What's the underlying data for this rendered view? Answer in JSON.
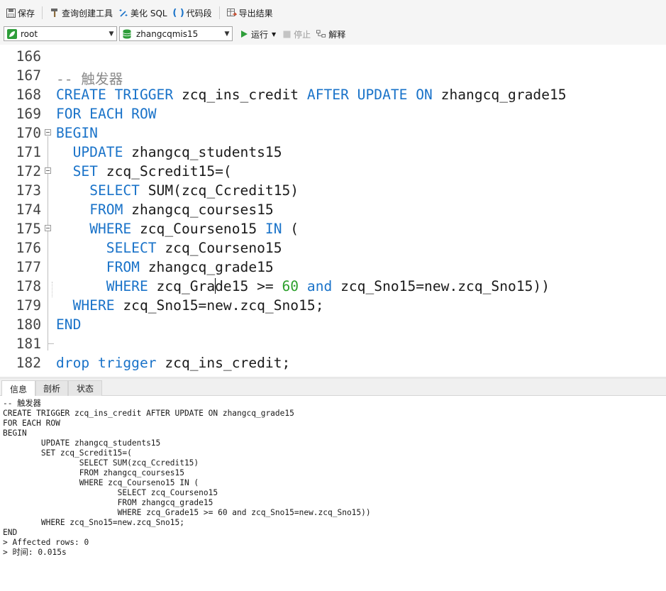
{
  "toolbar": {
    "save": "保存",
    "query_builder": "查询创建工具",
    "beautify_sql": "美化 SQL",
    "code_snippet": "代码段",
    "export_results": "导出结果"
  },
  "connection": {
    "user": "root",
    "database": "zhangcqmis15",
    "run": "运行",
    "stop": "停止",
    "explain": "解释"
  },
  "editor": {
    "lines": [
      {
        "n": "166",
        "text": ""
      },
      {
        "n": "167",
        "text": "-- 触发器"
      },
      {
        "n": "168",
        "text": "CREATE TRIGGER zcq_ins_credit AFTER UPDATE ON zhangcq_grade15"
      },
      {
        "n": "169",
        "text": "FOR EACH ROW"
      },
      {
        "n": "170",
        "text": "BEGIN"
      },
      {
        "n": "171",
        "text": "  UPDATE zhangcq_students15"
      },
      {
        "n": "172",
        "text": "  SET zcq_Scredit15=("
      },
      {
        "n": "173",
        "text": "    SELECT SUM(zcq_Ccredit15)"
      },
      {
        "n": "174",
        "text": "    FROM zhangcq_courses15"
      },
      {
        "n": "175",
        "text": "    WHERE zcq_Courseno15 IN ("
      },
      {
        "n": "176",
        "text": "      SELECT zcq_Courseno15"
      },
      {
        "n": "177",
        "text": "      FROM zhangcq_grade15"
      },
      {
        "n": "178",
        "text": "      WHERE zcq_Grade15 >= 60 and zcq_Sno15=new.zcq_Sno15))"
      },
      {
        "n": "179",
        "text": "  WHERE zcq_Sno15=new.zcq_Sno15;"
      },
      {
        "n": "180",
        "text": "END"
      },
      {
        "n": "181",
        "text": ""
      },
      {
        "n": "182",
        "text": "drop trigger zcq_ins_credit;"
      }
    ]
  },
  "panel": {
    "tabs": [
      "信息",
      "剖析",
      "状态"
    ],
    "output": [
      "-- 触发器",
      "CREATE TRIGGER zcq_ins_credit AFTER UPDATE ON zhangcq_grade15",
      "FOR EACH ROW",
      "BEGIN",
      "        UPDATE zhangcq_students15",
      "        SET zcq_Scredit15=(",
      "                SELECT SUM(zcq_Ccredit15)",
      "                FROM zhangcq_courses15",
      "                WHERE zcq_Courseno15 IN (",
      "                        SELECT zcq_Courseno15",
      "                        FROM zhangcq_grade15",
      "                        WHERE zcq_Grade15 >= 60 and zcq_Sno15=new.zcq_Sno15))",
      "        WHERE zcq_Sno15=new.zcq_Sno15;",
      "END",
      "> Affected rows: 0",
      "> 时间: 0.015s"
    ]
  },
  "icons": {
    "save": "save-icon",
    "query_builder": "hammer-icon",
    "beautify": "magic-wand-icon",
    "snippet": "parentheses-icon",
    "export": "export-table-icon",
    "connection": "leaf-icon",
    "database": "database-icon",
    "run": "play-icon",
    "stop": "stop-icon",
    "explain": "explain-icon"
  },
  "colors": {
    "keyword": "#1a73c9",
    "number": "#2ca02c",
    "comment": "#8a8a8a",
    "run_icon": "#2e9e3a",
    "connection_icon": "#2e9e3a"
  }
}
